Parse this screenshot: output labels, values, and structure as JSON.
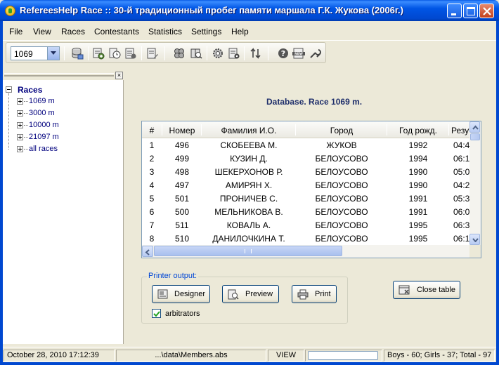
{
  "window": {
    "title": "RefereesHelp Race :: 30-й традиционный пробег памяти маршала Г.К. Жукова (2006г.)"
  },
  "menu": [
    "File",
    "View",
    "Races",
    "Contestants",
    "Statistics",
    "Settings",
    "Help"
  ],
  "toolbar": {
    "race_select_value": "1069",
    "icons": [
      "database-icon",
      "add-record-icon",
      "timer-icon",
      "results-icon",
      "edit-list-icon",
      "group-icon",
      "search-book-icon",
      "gear-icon",
      "report-icon",
      "sort-icon",
      "help-icon",
      "new-icon",
      "tools-icon"
    ]
  },
  "left_panel": {
    "tree_root": "Races",
    "tree_items": [
      "1069 m",
      "3000 m",
      "10000 m",
      "21097 m",
      "all races"
    ]
  },
  "main": {
    "db_title": "Database. Race 1069 m.",
    "table": {
      "columns": [
        "#",
        "Номер",
        "Фамилия И.О.",
        "Город",
        "Год рожд.",
        "Резу"
      ],
      "rows": [
        [
          "1",
          "496",
          "СКОБЕЕВА М.",
          "ЖУКОВ",
          "1992",
          "04:4"
        ],
        [
          "2",
          "499",
          "КУЗИН Д.",
          "БЕЛОУСОВО",
          "1994",
          "06:1"
        ],
        [
          "3",
          "498",
          "ШЕКЕРХОНОВ Р.",
          "БЕЛОУСОВО",
          "1990",
          "05:0"
        ],
        [
          "4",
          "497",
          "АМИРЯН Х.",
          "БЕЛОУСОВО",
          "1990",
          "04:2"
        ],
        [
          "5",
          "501",
          "ПРОНИЧЕВ С.",
          "БЕЛОУСОВО",
          "1991",
          "05:3"
        ],
        [
          "6",
          "500",
          "МЕЛЬНИКОВА В.",
          "БЕЛОУСОВО",
          "1991",
          "06:0"
        ],
        [
          "7",
          "511",
          "КОВАЛЬ А.",
          "БЕЛОУСОВО",
          "1995",
          "06:3"
        ],
        [
          "8",
          "510",
          "ДАНИЛОЧКИНА Т.",
          "БЕЛОУСОВО",
          "1995",
          "06:1"
        ]
      ]
    },
    "printer_group_label": "Printer output:",
    "designer_label": "Designer",
    "preview_label": "Preview",
    "print_label": "Print",
    "arbitrators_label": "arbitrators",
    "arbitrators_checked": true,
    "close_table_label": "Close table"
  },
  "status": {
    "datetime": "October 28, 2010 17:12:39",
    "file": "...\\data\\Members.abs",
    "mode": "VIEW",
    "counts": "Boys - 60;  Girls - 37;  Total - 97"
  },
  "colors": {
    "title_bar": "#0055e5",
    "db_title": "#1f2f6b",
    "tree_text": "#00007e",
    "group_label": "#0046d5"
  }
}
